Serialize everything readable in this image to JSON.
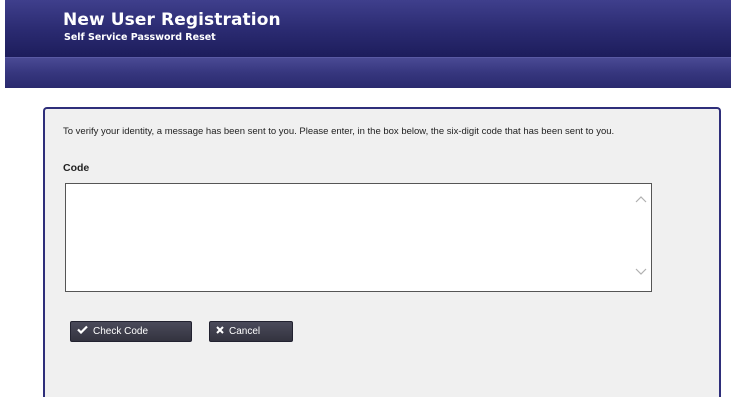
{
  "header": {
    "title": "New User Registration",
    "subtitle": "Self Service Password Reset"
  },
  "main": {
    "instructions": "To verify your identity, a message has been sent to you. Please enter, in the box below, the six-digit code that has been sent to you.",
    "code_label": "Code",
    "code_value": "",
    "buttons": {
      "check_code_label": "Check Code",
      "cancel_label": "Cancel"
    }
  },
  "icons": {
    "check": "checkmark-icon",
    "cancel": "x-icon",
    "scroll_up": "chevron-up-icon",
    "scroll_down": "chevron-down-icon"
  },
  "colors": {
    "header_bg": "#2a2a70",
    "panel_border": "#2e2e7a",
    "panel_bg": "#f0f0f0",
    "button_bg": "#3a3a48"
  }
}
